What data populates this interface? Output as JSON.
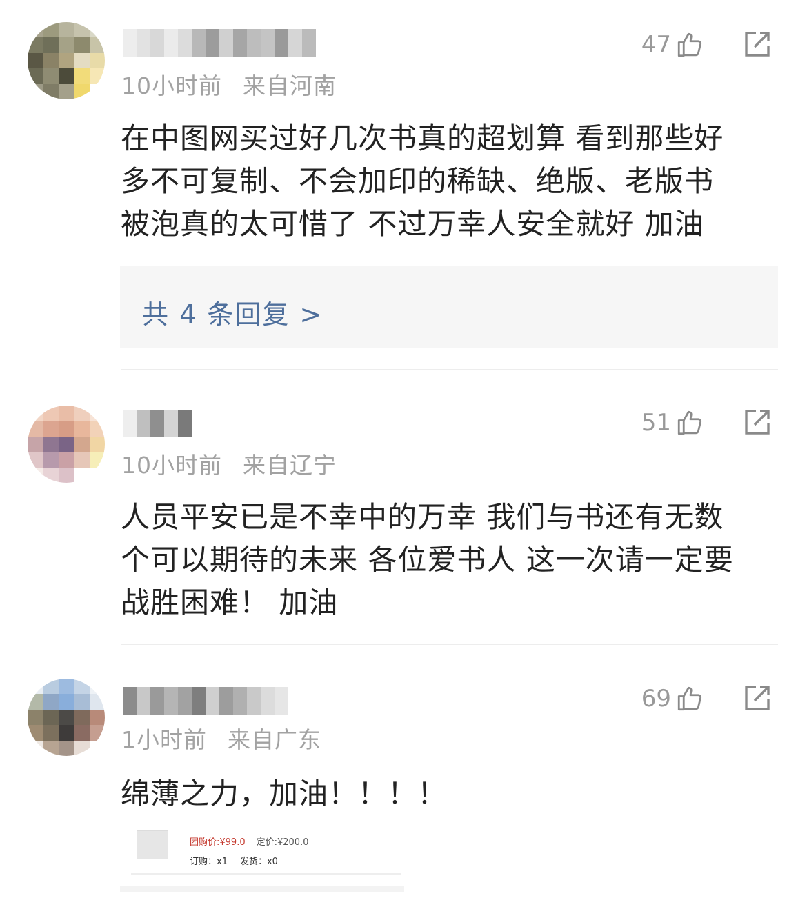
{
  "comments": [
    {
      "likes": "47",
      "time": "10小时前",
      "location": "来自河南",
      "lines": [
        "在中图网买过好几次书真的超划算 看到那些好",
        "多不可复制、不会加印的稀缺、绝版、老版书",
        "被泡真的太可惜了 不过万幸人安全就好 加油"
      ],
      "replies_label": "共 4 条回复 >"
    },
    {
      "likes": "51",
      "time": "10小时前",
      "location": "来自辽宁",
      "lines": [
        "人员平安已是不幸中的万幸 我们与书还有无数",
        "个可以期待的未来 各位爱书人 这一次请一定要",
        "战胜困难！ 加油"
      ]
    },
    {
      "likes": "69",
      "time": "1小时前",
      "location": "来自广东",
      "lines": [
        "绵薄之力，加油！！！！"
      ],
      "product": {
        "group_price": "团购价:¥99.0",
        "list_price": "定价:¥200.0",
        "ordered": "订购：x1",
        "shipped": "发货：x0"
      }
    }
  ],
  "icons": [
    "thumbs-up-icon",
    "share-icon"
  ],
  "colors": {
    "reply_link": "#4e6f9c",
    "meta_text": "#a2a2a2",
    "group_price": "#c53a2f"
  }
}
